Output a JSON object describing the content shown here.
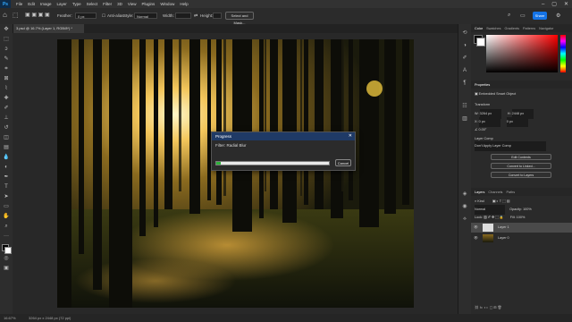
{
  "menubar": {
    "app_logo": "Ps",
    "items": [
      "File",
      "Edit",
      "Image",
      "Layer",
      "Type",
      "Select",
      "Filter",
      "3D",
      "View",
      "Plugins",
      "Window",
      "Help"
    ]
  },
  "options": {
    "feather_label": "Feather:",
    "feather_value": "0 px",
    "anti_alias_label": "Anti-alias",
    "style_label": "Style:",
    "style_value": "Normal",
    "width_label": "Width:",
    "height_label": "Height:",
    "select_mask_button": "Select and Mask...",
    "share_button": "Share"
  },
  "document": {
    "tab_label": "3.psd @ 16.7% (Layer 1, RGB/8*) *"
  },
  "status": {
    "zoom": "16.67%",
    "doc_size": "3264 px x 2448 px (72 ppi)"
  },
  "dialog": {
    "title": "Progress",
    "message": "Filter: Radial Blur",
    "cancel": "Cancel",
    "progress": 0.04
  },
  "color_panel": {
    "tabs": [
      "Color",
      "Swatches",
      "Gradients",
      "Patterns",
      "Navigator"
    ],
    "hue_color": "#ff0000"
  },
  "properties": {
    "tabs": [
      "Properties"
    ],
    "type_label": "Embedded Smart Object",
    "transform_label": "Transform",
    "w_label": "W:",
    "w_value": "3264 px",
    "h_label": "H:",
    "h_value": "2448 px",
    "x_label": "X:",
    "x_value": "0 px",
    "y_value": "0 px",
    "angle_value": "0.00°",
    "layer_comp_label": "Layer Comp",
    "layer_comp_value": "Don't Apply Layer Comp",
    "edit_contents": "Edit Contents",
    "convert_linked": "Convert to Linked...",
    "convert_layers": "Convert to Layers"
  },
  "layers_panel": {
    "tabs": [
      "Layers",
      "Channels",
      "Paths"
    ],
    "kind_label": "Kind",
    "blend_mode": "Normal",
    "opacity_label": "Opacity:",
    "opacity_value": "100%",
    "lock_label": "Lock:",
    "fill_label": "Fill:",
    "fill_value": "100%",
    "layers": [
      {
        "name": "Layer 1"
      },
      {
        "name": "Layer 0"
      }
    ]
  },
  "accent": "#31a8ff"
}
